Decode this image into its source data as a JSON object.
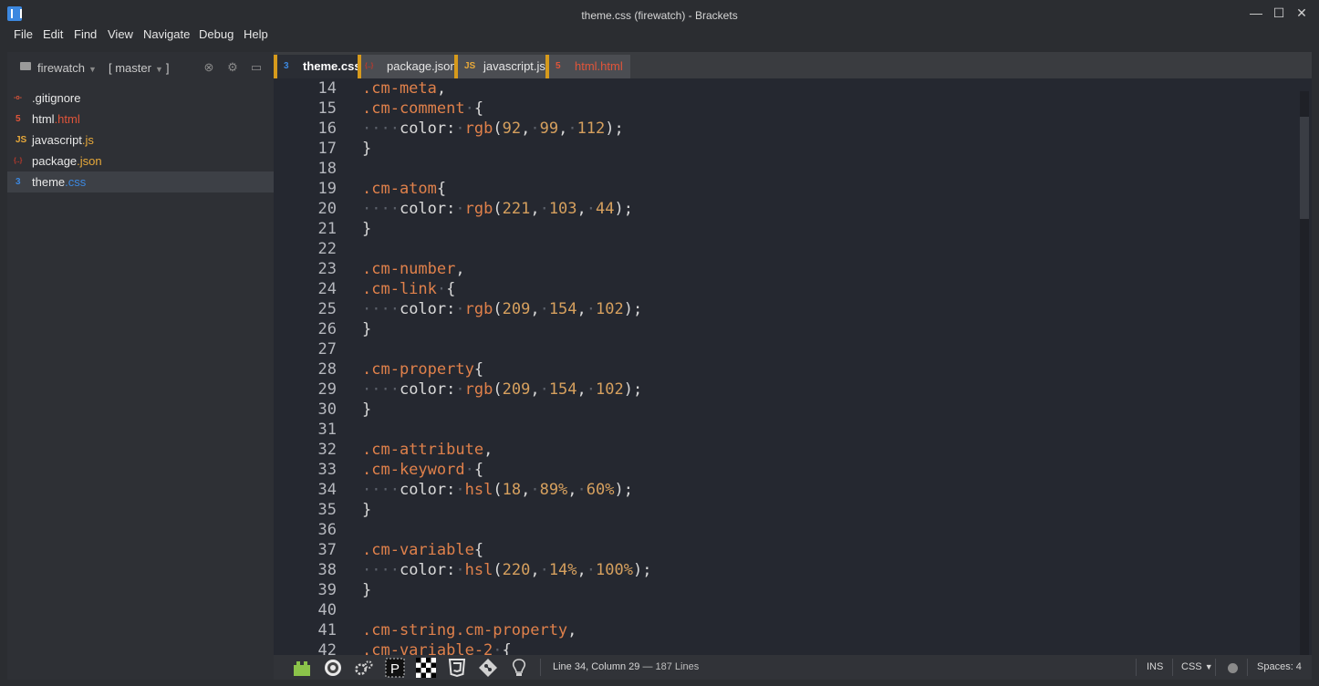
{
  "window": {
    "title": "theme.css (firewatch) - Brackets",
    "controls": {
      "minimize": "—",
      "maximize": "☐",
      "close": "✕"
    }
  },
  "menu": [
    "File",
    "Edit",
    "Find",
    "View",
    "Navigate",
    "Debug",
    "Help"
  ],
  "sidebar": {
    "project": "firewatch",
    "branch": "[ master",
    "files": [
      {
        "icon": "git-icon",
        "glyph": "-o-",
        "name": ".gitignore",
        "ext": "",
        "ext_color": "#e8e8e8",
        "icon_color": "#e0553a"
      },
      {
        "icon": "html5-icon",
        "glyph": "5",
        "name": "html",
        "ext": ".html",
        "ext_color": "#e0553a",
        "icon_color": "#e0553a"
      },
      {
        "icon": "js-icon",
        "glyph": "JS",
        "name": "javascript",
        "ext": ".js",
        "ext_color": "#e8a93a",
        "icon_color": "#e8a93a"
      },
      {
        "icon": "json-icon",
        "glyph": "{..}",
        "name": "package",
        "ext": ".json",
        "ext_color": "#e8a93a",
        "icon_color": "#c0392b"
      },
      {
        "icon": "css3-icon",
        "glyph": "3",
        "name": "theme",
        "ext": ".css",
        "ext_color": "#3c88e0",
        "icon_color": "#3c88e0",
        "selected": true
      }
    ]
  },
  "tabs": [
    {
      "label": "theme.css",
      "icon": "css3-icon",
      "glyph": "3",
      "icon_color": "#3c88e0",
      "color": "#ffffff",
      "active": true
    },
    {
      "label": "package.json",
      "icon": "json-icon",
      "glyph": "{..}",
      "icon_color": "#c0392b",
      "color": "#e6e6e6",
      "active": false
    },
    {
      "label": "javascript.js",
      "icon": "js-icon",
      "glyph": "JS",
      "icon_color": "#e8a93a",
      "color": "#e6e6e6",
      "active": false
    },
    {
      "label": "html.html",
      "icon": "html5-icon",
      "glyph": "5",
      "icon_color": "#e0553a",
      "color": "#e0553a",
      "active": false
    }
  ],
  "code_lines": [
    {
      "n": "14",
      "segs": [
        [
          "sel",
          ".cm-meta"
        ],
        [
          "p",
          ","
        ]
      ]
    },
    {
      "n": "15",
      "segs": [
        [
          "sel",
          ".cm-comment"
        ],
        [
          "ws",
          "·"
        ],
        [
          "p",
          "{"
        ]
      ]
    },
    {
      "n": "16",
      "segs": [
        [
          "ws",
          "····"
        ],
        [
          "p",
          "color:"
        ],
        [
          "ws",
          "·"
        ],
        [
          "fn",
          "rgb"
        ],
        [
          "p",
          "("
        ],
        [
          "num",
          "92"
        ],
        [
          "p",
          ","
        ],
        [
          "ws",
          "·"
        ],
        [
          "num",
          "99"
        ],
        [
          "p",
          ","
        ],
        [
          "ws",
          "·"
        ],
        [
          "num",
          "112"
        ],
        [
          "p",
          ");"
        ]
      ]
    },
    {
      "n": "17",
      "segs": [
        [
          "p",
          "}"
        ]
      ]
    },
    {
      "n": "18",
      "segs": []
    },
    {
      "n": "19",
      "segs": [
        [
          "sel",
          ".cm-atom"
        ],
        [
          "p",
          "{"
        ]
      ]
    },
    {
      "n": "20",
      "segs": [
        [
          "ws",
          "····"
        ],
        [
          "p",
          "color:"
        ],
        [
          "ws",
          "·"
        ],
        [
          "fn",
          "rgb"
        ],
        [
          "p",
          "("
        ],
        [
          "num",
          "221"
        ],
        [
          "p",
          ","
        ],
        [
          "ws",
          "·"
        ],
        [
          "num",
          "103"
        ],
        [
          "p",
          ","
        ],
        [
          "ws",
          "·"
        ],
        [
          "num",
          "44"
        ],
        [
          "p",
          ");"
        ]
      ]
    },
    {
      "n": "21",
      "segs": [
        [
          "p",
          "}"
        ]
      ]
    },
    {
      "n": "22",
      "segs": []
    },
    {
      "n": "23",
      "segs": [
        [
          "sel",
          ".cm-number"
        ],
        [
          "p",
          ","
        ]
      ]
    },
    {
      "n": "24",
      "segs": [
        [
          "sel",
          ".cm-link"
        ],
        [
          "ws",
          "·"
        ],
        [
          "p",
          "{"
        ]
      ]
    },
    {
      "n": "25",
      "segs": [
        [
          "ws",
          "····"
        ],
        [
          "p",
          "color:"
        ],
        [
          "ws",
          "·"
        ],
        [
          "fn",
          "rgb"
        ],
        [
          "p",
          "("
        ],
        [
          "num",
          "209"
        ],
        [
          "p",
          ","
        ],
        [
          "ws",
          "·"
        ],
        [
          "num",
          "154"
        ],
        [
          "p",
          ","
        ],
        [
          "ws",
          "·"
        ],
        [
          "num",
          "102"
        ],
        [
          "p",
          ");"
        ]
      ]
    },
    {
      "n": "26",
      "segs": [
        [
          "p",
          "}"
        ]
      ]
    },
    {
      "n": "27",
      "segs": []
    },
    {
      "n": "28",
      "segs": [
        [
          "sel",
          ".cm-property"
        ],
        [
          "p",
          "{"
        ]
      ]
    },
    {
      "n": "29",
      "segs": [
        [
          "ws",
          "····"
        ],
        [
          "p",
          "color:"
        ],
        [
          "ws",
          "·"
        ],
        [
          "fn",
          "rgb"
        ],
        [
          "p",
          "("
        ],
        [
          "num",
          "209"
        ],
        [
          "p",
          ","
        ],
        [
          "ws",
          "·"
        ],
        [
          "num",
          "154"
        ],
        [
          "p",
          ","
        ],
        [
          "ws",
          "·"
        ],
        [
          "num",
          "102"
        ],
        [
          "p",
          ");"
        ]
      ]
    },
    {
      "n": "30",
      "segs": [
        [
          "p",
          "}"
        ]
      ]
    },
    {
      "n": "31",
      "segs": []
    },
    {
      "n": "32",
      "segs": [
        [
          "sel",
          ".cm-attribute"
        ],
        [
          "p",
          ","
        ]
      ]
    },
    {
      "n": "33",
      "segs": [
        [
          "sel",
          ".cm-keyword"
        ],
        [
          "ws",
          "·"
        ],
        [
          "p",
          "{"
        ]
      ]
    },
    {
      "n": "34",
      "segs": [
        [
          "ws",
          "····"
        ],
        [
          "p",
          "color:"
        ],
        [
          "ws",
          "·"
        ],
        [
          "fn",
          "hsl"
        ],
        [
          "p",
          "("
        ],
        [
          "num",
          "18"
        ],
        [
          "p",
          ","
        ],
        [
          "ws",
          "·"
        ],
        [
          "num",
          "89%"
        ],
        [
          "p",
          ","
        ],
        [
          "ws",
          "·"
        ],
        [
          "num",
          "60%"
        ],
        [
          "p",
          ");"
        ]
      ]
    },
    {
      "n": "35",
      "segs": [
        [
          "p",
          "}"
        ]
      ]
    },
    {
      "n": "36",
      "segs": []
    },
    {
      "n": "37",
      "segs": [
        [
          "sel",
          ".cm-variable"
        ],
        [
          "p",
          "{"
        ]
      ]
    },
    {
      "n": "38",
      "segs": [
        [
          "ws",
          "····"
        ],
        [
          "p",
          "color:"
        ],
        [
          "ws",
          "·"
        ],
        [
          "fn",
          "hsl"
        ],
        [
          "p",
          "("
        ],
        [
          "num",
          "220"
        ],
        [
          "p",
          ","
        ],
        [
          "ws",
          "·"
        ],
        [
          "num",
          "14%"
        ],
        [
          "p",
          ","
        ],
        [
          "ws",
          "·"
        ],
        [
          "num",
          "100%"
        ],
        [
          "p",
          ");"
        ]
      ]
    },
    {
      "n": "39",
      "segs": [
        [
          "p",
          "}"
        ]
      ]
    },
    {
      "n": "40",
      "segs": []
    },
    {
      "n": "41",
      "segs": [
        [
          "sel",
          ".cm-string.cm-property"
        ],
        [
          "p",
          ","
        ]
      ]
    },
    {
      "n": "42",
      "segs": [
        [
          "sel",
          ".cm-variable-2"
        ],
        [
          "ws",
          "·"
        ],
        [
          "p",
          "{"
        ]
      ]
    }
  ],
  "status": {
    "cursor": "Line 34, Column 29",
    "lines": "— 187 Lines",
    "mode": "INS",
    "language": "CSS",
    "spaces": "Spaces: 4",
    "icons": [
      "extension-icon",
      "inspector-icon",
      "gears-icon",
      "p-letter-icon",
      "checkerboard-icon",
      "css3-icon",
      "git-icon",
      "lightbulb-icon"
    ]
  }
}
